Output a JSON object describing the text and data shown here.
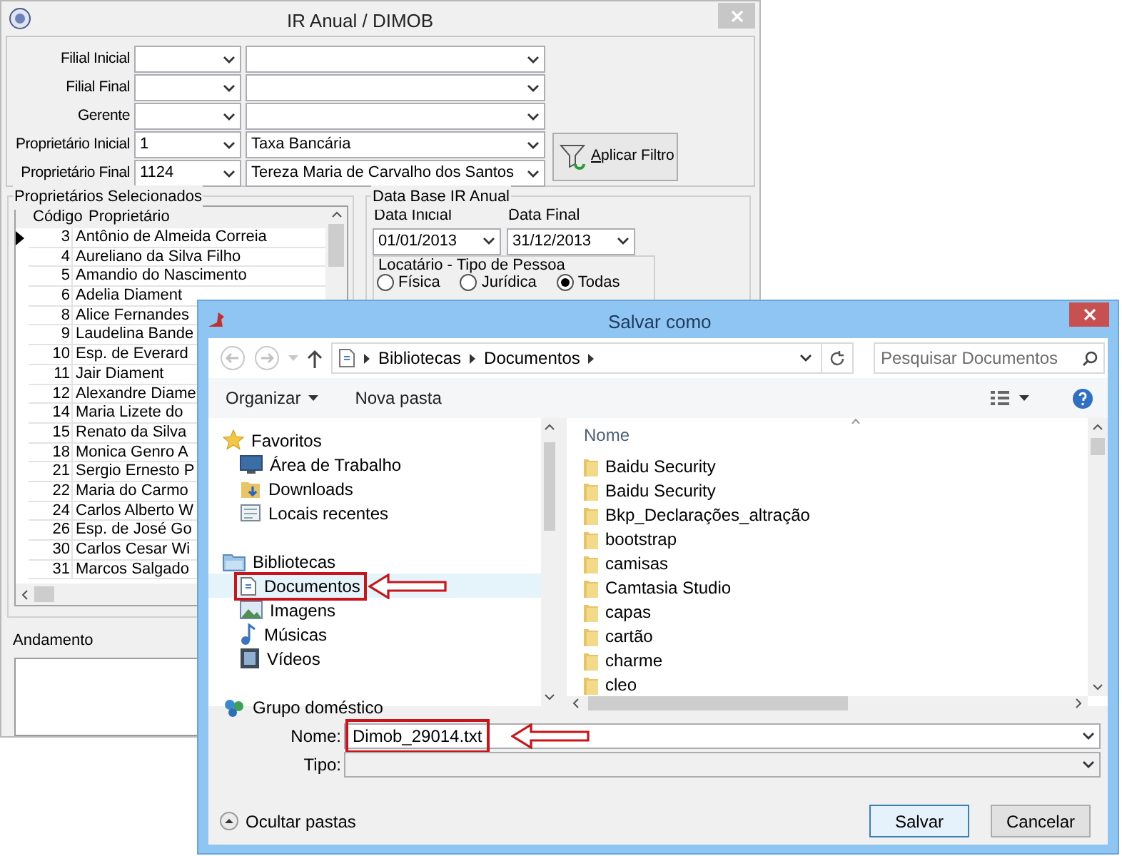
{
  "main_window": {
    "title": "IR Anual / DIMOB",
    "filters": [
      {
        "label": "Filial Inicial"
      },
      {
        "label": "Filial Final"
      },
      {
        "label": "Gerente"
      },
      {
        "label": "Proprietário Inicial",
        "code": "1",
        "name": "Taxa Bancária"
      },
      {
        "label": "Proprietário Final",
        "code": "1124",
        "name": "Tereza Maria de Carvalho dos Santos"
      }
    ],
    "apply_button": "Aplicar Filtro",
    "owners_group": {
      "title": "Proprietários Selecionados",
      "columns": [
        "Código",
        "Proprietário"
      ],
      "rows": [
        {
          "code": "3",
          "name": "Antônio de Almeida Correia",
          "selected": true
        },
        {
          "code": "4",
          "name": "Aureliano da Silva Filho",
          "selected": false
        },
        {
          "code": "5",
          "name": "Amandio do Nascimento",
          "selected": false
        },
        {
          "code": "6",
          "name": "Adelia Diament",
          "selected": false
        },
        {
          "code": "8",
          "name": "Alice Fernandes",
          "selected": false
        },
        {
          "code": "9",
          "name": "Laudelina Bande",
          "selected": false
        },
        {
          "code": "10",
          "name": "Esp. de Everard",
          "selected": false
        },
        {
          "code": "11",
          "name": "Jair Diament",
          "selected": false
        },
        {
          "code": "12",
          "name": "Alexandre Diame",
          "selected": false
        },
        {
          "code": "14",
          "name": "Maria Lizete do",
          "selected": false
        },
        {
          "code": "15",
          "name": "Renato da Silva",
          "selected": false
        },
        {
          "code": "18",
          "name": "Monica Genro A",
          "selected": false
        },
        {
          "code": "21",
          "name": "Sergio Ernesto P",
          "selected": false
        },
        {
          "code": "22",
          "name": "Maria do Carmo",
          "selected": false
        },
        {
          "code": "24",
          "name": "Carlos Alberto W",
          "selected": false
        },
        {
          "code": "26",
          "name": "Esp. de José Go",
          "selected": false
        },
        {
          "code": "30",
          "name": "Carlos Cesar Wi",
          "selected": false
        },
        {
          "code": "31",
          "name": "Marcos Salgado",
          "selected": false
        }
      ]
    },
    "date_group": {
      "title": "Data Base IR Anual",
      "start": {
        "label": "Data Inicial",
        "value": "01/01/2013"
      },
      "end": {
        "label": "Data Final",
        "value": "31/12/2013"
      },
      "person_type": {
        "title": "Locatário - Tipo de Pessoa",
        "options": [
          {
            "label": "Física",
            "selected": false
          },
          {
            "label": "Jurídica",
            "selected": false
          },
          {
            "label": "Todas",
            "selected": true
          }
        ]
      }
    },
    "progress": {
      "label": "Andamento"
    }
  },
  "save_dialog": {
    "title": "Salvar como",
    "path": [
      "Bibliotecas",
      "Documentos"
    ],
    "search_placeholder": "Pesquisar Documentos",
    "toolbar": [
      {
        "label": "Organizar",
        "kind": "menu"
      },
      {
        "label": "Nova pasta",
        "kind": "button"
      }
    ],
    "nav": [
      {
        "label": "Favoritos",
        "kind": "star",
        "selected": false,
        "highlighted": false,
        "children": [
          {
            "label": "Área de Trabalho",
            "kind": "desktop",
            "selected": false,
            "highlighted": false
          },
          {
            "label": "Downloads",
            "kind": "download",
            "selected": false,
            "highlighted": false
          },
          {
            "label": "Locais recentes",
            "kind": "recent",
            "selected": false,
            "highlighted": false
          }
        ]
      },
      {
        "label": "Bibliotecas",
        "kind": "library",
        "selected": false,
        "highlighted": false,
        "children": [
          {
            "label": "Documentos",
            "kind": "document",
            "selected": true,
            "highlighted": true
          },
          {
            "label": "Imagens",
            "kind": "image",
            "selected": false,
            "highlighted": false
          },
          {
            "label": "Músicas",
            "kind": "music",
            "selected": false,
            "highlighted": false
          },
          {
            "label": "Vídeos",
            "kind": "video",
            "selected": false,
            "highlighted": false
          }
        ]
      },
      {
        "label": "Grupo doméstico",
        "kind": "homegroup",
        "selected": false,
        "highlighted": false
      }
    ],
    "files_column": "Nome",
    "files": [
      "Baidu Security",
      "Baidu Security",
      "Bkp_Declarações_altração",
      "bootstrap",
      "camisas",
      "Camtasia Studio",
      "capas",
      "cartão",
      "charme",
      "cleo"
    ],
    "name_field": {
      "label": "Nome:",
      "value": "Dimob_29014.txt",
      "highlighted": true
    },
    "type_field": {
      "label": "Tipo:"
    },
    "hide_folders": "Ocultar pastas",
    "buttons": [
      {
        "label": "Salvar",
        "default": true
      },
      {
        "label": "Cancelar",
        "default": false
      }
    ]
  }
}
